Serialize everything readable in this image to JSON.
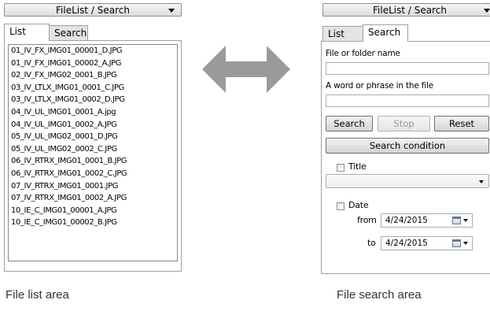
{
  "list_panel": {
    "dropdown_label": "FileList / Search",
    "tabs": [
      {
        "label": "List",
        "active": true
      },
      {
        "label": "Search",
        "active": false
      }
    ],
    "files": [
      "01_IV_FX_IMG01_00001_D.JPG",
      "01_IV_FX_IMG01_00002_A.JPG",
      "02_IV_FX_IMG02_0001_B.JPG",
      "03_IV_LTLX_IMG01_0001_C.JPG",
      "03_IV_LTLX_IMG01_0002_D.JPG",
      "04_IV_UL_IMG01_0001_A.jpg",
      "04_IV_UL_IMG01_0002_A.JPG",
      "05_IV_UL_IMG02_0001_D.JPG",
      "05_IV_UL_IMG02_0002_C.JPG",
      "06_IV_RTRX_IMG01_0001_B.JPG",
      "06_IV_RTRX_IMG01_0002_C.JPG",
      "07_IV_RTRX_IMG01_0001.JPG",
      "07_IV_RTRX_IMG01_0002_A.JPG",
      "10_IE_C_IMG01_00001_A.JPG",
      "10_IE_C_IMG01_00002_B.JPG"
    ]
  },
  "search_panel": {
    "dropdown_label": "FileList / Search",
    "tabs": [
      {
        "label": "List",
        "active": false
      },
      {
        "label": "Search",
        "active": true
      }
    ],
    "name_label": "File or folder name",
    "name_value": "",
    "phrase_label": "A word or phrase in the file",
    "phrase_value": "",
    "search_button": "Search",
    "stop_button": "Stop",
    "reset_button": "Reset",
    "condition_button": "Search condition",
    "title_checkbox_label": "Title",
    "title_checked": false,
    "title_select_value": "",
    "date_checkbox_label": "Date",
    "date_checked": false,
    "from_label": "from",
    "from_value": "4/24/2015",
    "to_label": "to",
    "to_value": "4/24/2015"
  },
  "captions": {
    "left": "File list area",
    "right": "File search area"
  },
  "icons": [
    "chevron-down-icon",
    "double-arrow-icon",
    "calendar-icon"
  ],
  "colors": {
    "arrow": "#9a9a9a",
    "tab_inactive": "#e4e4e4",
    "border": "#a0a0a0"
  }
}
